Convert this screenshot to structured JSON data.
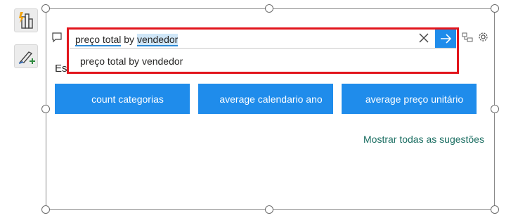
{
  "colors": {
    "accent": "#1f8ceb",
    "highlight_box": "#e2151c",
    "link": "#1b6e62"
  },
  "toolbar": {
    "icons": [
      "smart-narrative-icon",
      "format-paint-icon"
    ]
  },
  "qa": {
    "query_part1": "preço total",
    "query_part2": " by ",
    "query_part3": "vendedor",
    "suggestion": "preço total by vendedor",
    "prompt_prefix": "Es",
    "suggestion_buttons": [
      "count categorias",
      "average calendario ano",
      "average preço unitário"
    ],
    "show_all_label": "Mostrar todas as sugestões"
  }
}
